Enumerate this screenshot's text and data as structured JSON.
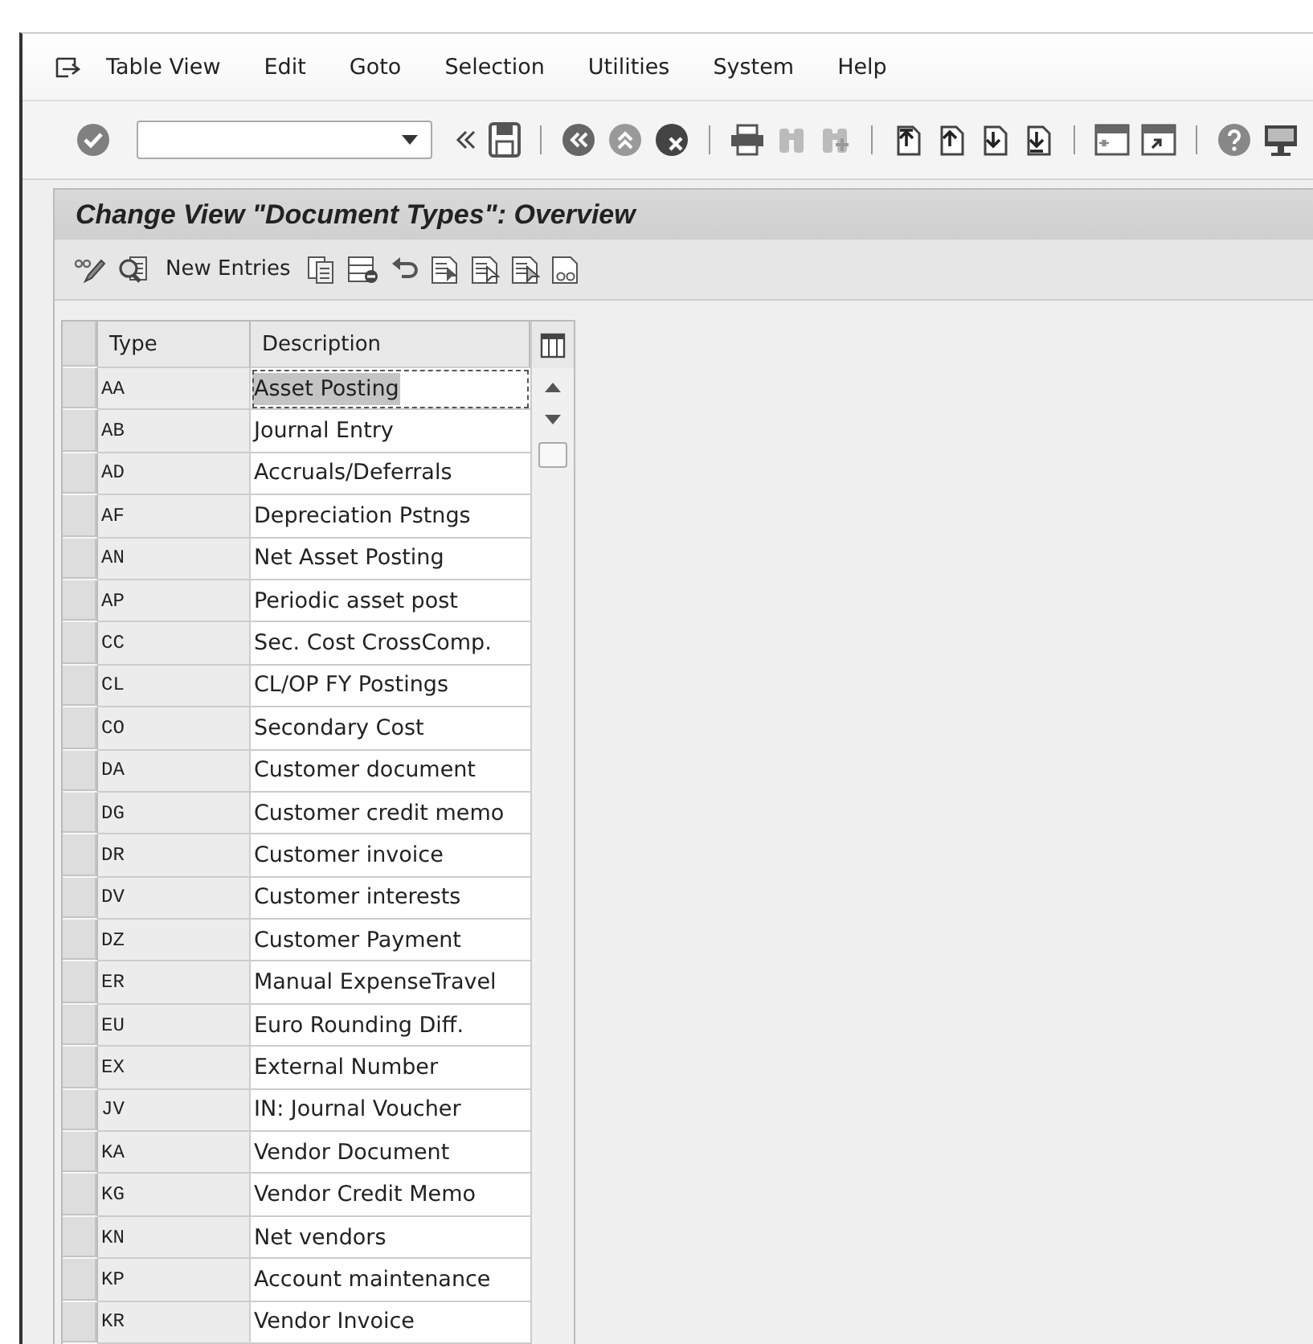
{
  "menu": [
    "Table View",
    "Edit",
    "Goto",
    "Selection",
    "Utilities",
    "System",
    "Help"
  ],
  "toolbar": [
    {
      "kind": "enter"
    },
    {
      "kind": "field"
    },
    {
      "kind": "collapse"
    },
    {
      "kind": "save"
    },
    {
      "kind": "separator"
    },
    {
      "kind": "back"
    },
    {
      "kind": "exit"
    },
    {
      "kind": "cancel"
    },
    {
      "kind": "separator"
    },
    {
      "kind": "print"
    },
    {
      "kind": "find"
    },
    {
      "kind": "findnext"
    },
    {
      "kind": "separator"
    },
    {
      "kind": "first"
    },
    {
      "kind": "previous"
    },
    {
      "kind": "next"
    },
    {
      "kind": "last"
    },
    {
      "kind": "separator"
    },
    {
      "kind": "session"
    },
    {
      "kind": "shortcut"
    },
    {
      "kind": "separator"
    },
    {
      "kind": "help"
    },
    {
      "kind": "layout"
    }
  ],
  "title": "Change View \"Document Types\": Overview",
  "app_toolbar": [
    {
      "kind": "toggle"
    },
    {
      "kind": "details"
    },
    {
      "kind": "button",
      "label": "New Entries"
    },
    {
      "kind": "copy"
    },
    {
      "kind": "delete"
    },
    {
      "kind": "undo"
    },
    {
      "kind": "selectall"
    },
    {
      "kind": "selectblock"
    },
    {
      "kind": "deselect"
    },
    {
      "kind": "view"
    }
  ],
  "table": {
    "columns": [
      "Type",
      "Description"
    ],
    "rows": [
      {
        "type": "AA",
        "description": "Asset Posting",
        "selected": true
      },
      {
        "type": "AB",
        "description": "Journal Entry",
        "selected": false
      },
      {
        "type": "AD",
        "description": "Accruals/Deferrals",
        "selected": false
      },
      {
        "type": "AF",
        "description": "Depreciation Pstngs",
        "selected": false
      },
      {
        "type": "AN",
        "description": "Net Asset Posting",
        "selected": false
      },
      {
        "type": "AP",
        "description": "Periodic asset post",
        "selected": false
      },
      {
        "type": "CC",
        "description": "Sec. Cost CrossComp.",
        "selected": false
      },
      {
        "type": "CL",
        "description": "CL/OP FY Postings",
        "selected": false
      },
      {
        "type": "CO",
        "description": "Secondary Cost",
        "selected": false
      },
      {
        "type": "DA",
        "description": "Customer document",
        "selected": false
      },
      {
        "type": "DG",
        "description": "Customer credit memo",
        "selected": false
      },
      {
        "type": "DR",
        "description": "Customer invoice",
        "selected": false
      },
      {
        "type": "DV",
        "description": "Customer interests",
        "selected": false
      },
      {
        "type": "DZ",
        "description": "Customer Payment",
        "selected": false
      },
      {
        "type": "ER",
        "description": "Manual ExpenseTravel",
        "selected": false
      },
      {
        "type": "EU",
        "description": "Euro Rounding Diff.",
        "selected": false
      },
      {
        "type": "EX",
        "description": "External Number",
        "selected": false
      },
      {
        "type": "JV",
        "description": "IN: Journal Voucher",
        "selected": false
      },
      {
        "type": "KA",
        "description": "Vendor Document",
        "selected": false
      },
      {
        "type": "KG",
        "description": "Vendor Credit Memo",
        "selected": false
      },
      {
        "type": "KN",
        "description": "Net vendors",
        "selected": false
      },
      {
        "type": "KP",
        "description": "Account maintenance",
        "selected": false
      },
      {
        "type": "KR",
        "description": "Vendor Invoice",
        "selected": false
      }
    ]
  }
}
